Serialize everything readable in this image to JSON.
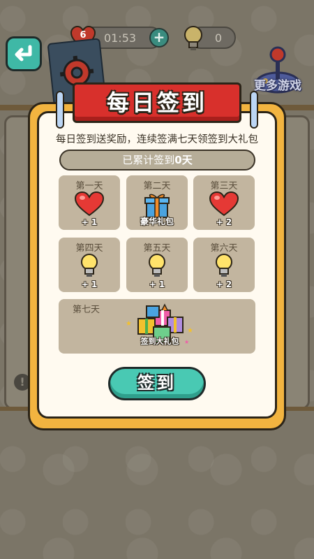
{
  "topbar": {
    "lives": "6",
    "timer": "01:53",
    "hints": "0",
    "more_games": "更多游戏"
  },
  "modal": {
    "title": "每日签到",
    "subtitle": "每日签到送奖励，连续签满七天领签到大礼包",
    "progress_prefix": "已累计签到",
    "progress_count": "0天",
    "days": [
      {
        "label": "第一天",
        "reward": "+ 1",
        "icon": "heart-icon"
      },
      {
        "label": "第二天",
        "reward": "豪华礼包",
        "icon": "gift-icon"
      },
      {
        "label": "第三天",
        "reward": "+ 2",
        "icon": "heart-icon"
      },
      {
        "label": "第四天",
        "reward": "+ 1",
        "icon": "lightbulb-icon"
      },
      {
        "label": "第五天",
        "reward": "+ 1",
        "icon": "lightbulb-icon"
      },
      {
        "label": "第六天",
        "reward": "+ 2",
        "icon": "lightbulb-icon"
      }
    ],
    "day7": {
      "label": "第七天",
      "reward": "签到大礼包",
      "icon": "gift-pile-icon"
    },
    "signin_label": "签到"
  },
  "colors": {
    "accent": "#49c9b3",
    "ribbon": "#d8302c",
    "frame": "#f2b440",
    "tile": "#c2b59f"
  }
}
